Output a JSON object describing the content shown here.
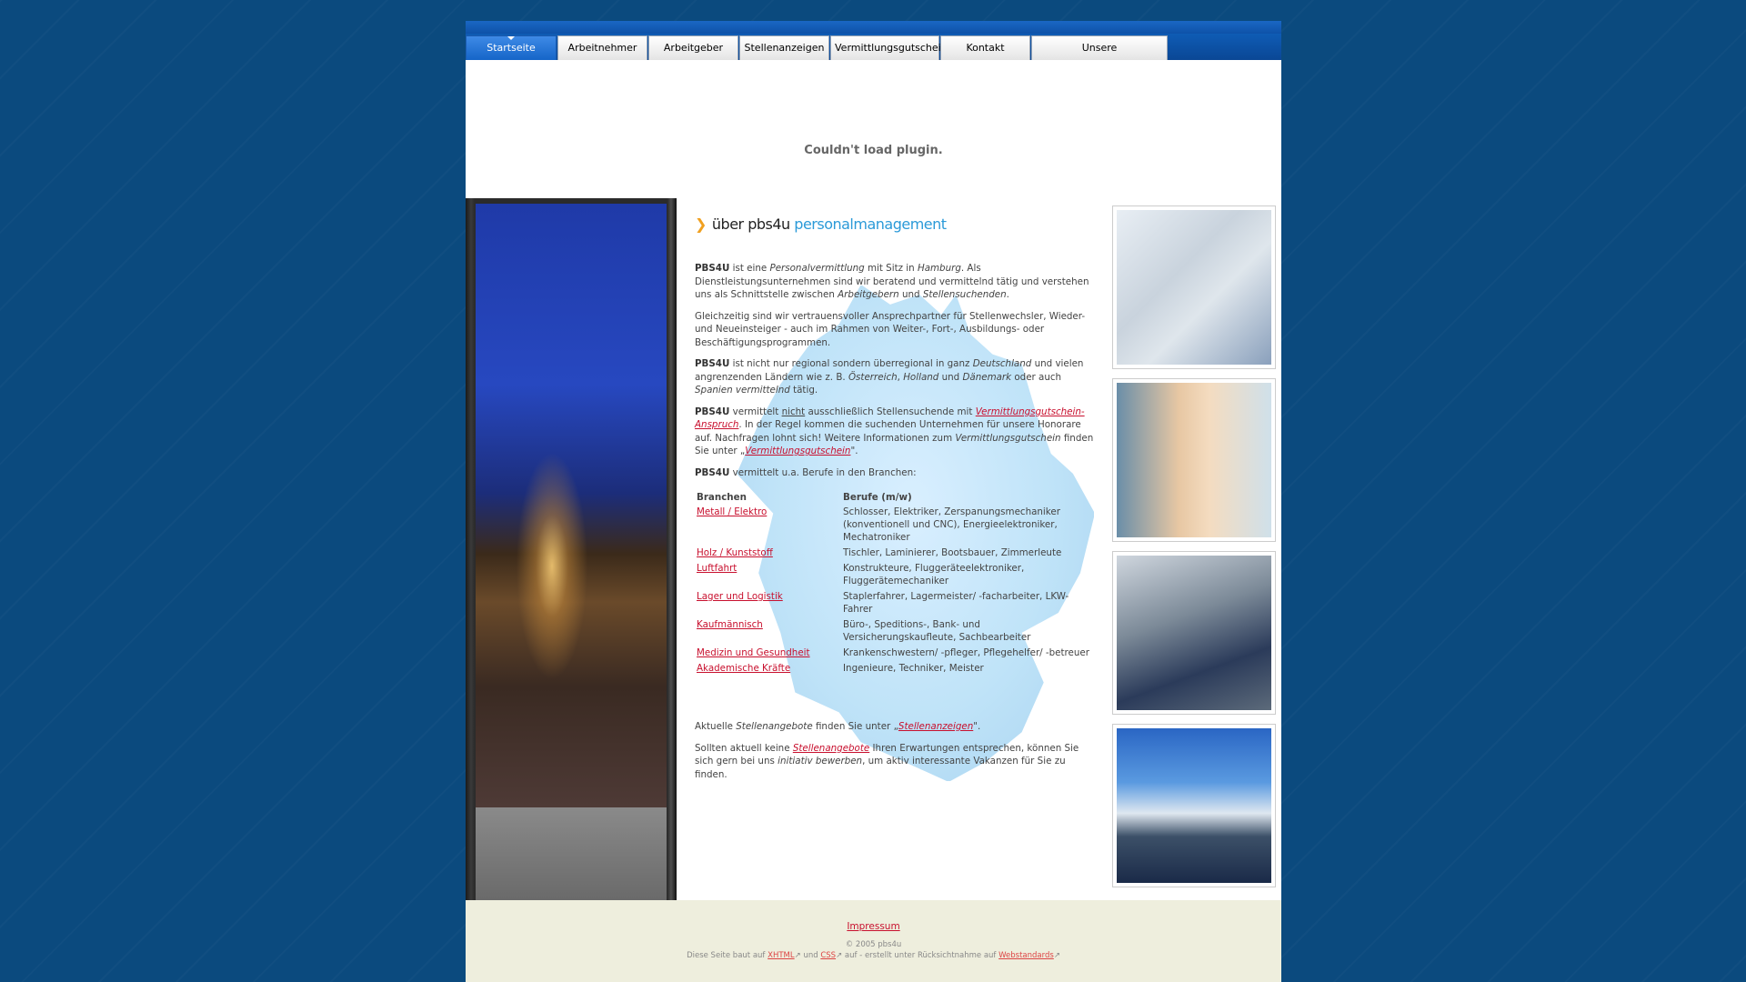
{
  "nav": [
    {
      "label": "Startseite",
      "active": true
    },
    {
      "label": "Arbeitnehmer"
    },
    {
      "label": "Arbeitgeber"
    },
    {
      "label": "Stellenanzeigen"
    },
    {
      "label": "Vermittlungsgutschein"
    },
    {
      "label": "Kontakt"
    },
    {
      "label": "Unsere Kooperationspartner"
    }
  ],
  "plugin_message": "Couldn't load plugin.",
  "heading": {
    "part1": "über pbs4u",
    "part2": "personalmanagement"
  },
  "body": {
    "p1": {
      "brand": "PBS4U",
      "t1": " ist eine ",
      "i1": "Personalvermittlung",
      "t2": " mit Sitz in ",
      "i2": "Hamburg",
      "t3": ". Als Dienstleistungsunternehmen sind wir beratend und vermittelnd tätig und verstehen uns als Schnittstelle zwischen ",
      "i3": "Arbeitgebern",
      "t4": " und ",
      "i4": "Stellensuchenden",
      "t5": "."
    },
    "p2": "Gleichzeitig sind wir vertrauensvoller Ansprechpartner für Stellenwechsler, Wieder- und Neueinsteiger - auch im Rahmen von Weiter-, Fort-, Ausbildungs- oder Beschäftigungsprogrammen.",
    "p3": {
      "brand": "PBS4U",
      "t1": " ist nicht nur regional sondern überregional in ganz ",
      "i1": "Deutschland",
      "t2": " und vielen angrenzenden Ländern wie z. B. ",
      "i2": "Österreich",
      "t3": ", ",
      "i3": "Holland",
      "t4": " und ",
      "i4": "Dänemark",
      "t5": " oder auch ",
      "i5": "Spanien vermittelnd",
      "t6": " tätig."
    },
    "p4": {
      "brand": "PBS4U",
      "t1": " vermittelt ",
      "u1": "nicht",
      "t2": " ausschließlich Stellensuchende mit ",
      "link1": "Vermittlungsgutschein-Anspruch",
      "t3": ". In der Regel kommen die suchenden Unternehmen für unsere Honorare auf. Nachfragen lohnt sich! Weitere Informationen zum ",
      "i1": "Vermittlungsgutschein",
      "t4": " finden Sie unter „",
      "link2": "Vermittlungsgutschein",
      "t5": "\"."
    },
    "p5": {
      "brand": "PBS4U",
      "t1": " vermittelt u.a. Berufe in den Branchen:"
    }
  },
  "table": {
    "headers": [
      "Branchen",
      "Berufe (m/w)"
    ],
    "rows": [
      {
        "branche": "Metall / Elektro",
        "berufe": "Schlosser, Elektriker, Zerspanungsmechaniker (konventionell und CNC), Energieelektroniker, Mechatroniker"
      },
      {
        "branche": "Holz / Kunststoff",
        "berufe": "Tischler, Laminierer, Bootsbauer, Zimmerleute"
      },
      {
        "branche": "Luftfahrt",
        "berufe": "Konstrukteure, Fluggeräteelektroniker, Fluggerätemechaniker"
      },
      {
        "branche": "Lager und Logistik",
        "berufe": "Staplerfahrer, Lagermeister/ -facharbeiter, LKW-Fahrer"
      },
      {
        "branche": "Kaufmännisch",
        "berufe": "Büro-, Speditions-, Bank- und Versicherungskaufleute, Sachbearbeiter"
      },
      {
        "branche": "Medizin und Gesundheit",
        "berufe": "Krankenschwestern/ -pfleger, Pflegehelfer/ -betreuer"
      },
      {
        "branche": "Akademische Kräfte",
        "berufe": "Ingenieure, Techniker, Meister"
      }
    ]
  },
  "after": {
    "p6": {
      "t1": "Aktuelle ",
      "i1": "Stellenangebote",
      "t2": " finden Sie unter „",
      "link1": "Stellenanzeigen",
      "t3": "\"."
    },
    "p7": {
      "t1": "Sollten aktuell keine ",
      "link1": "Stellenangebote",
      "t2": " Ihren Erwartungen entsprechen, können Sie sich gern bei uns ",
      "i1": "initiativ bewerben",
      "t3": ", um aktiv interessante Vakanzen für Sie zu finden."
    }
  },
  "footer": {
    "impressum": "Impressum",
    "copyright": "© 2005 pbs4u",
    "meta": {
      "t1": "Diese Seite baut auf ",
      "l1": "XHTML",
      "t2": " und ",
      "l2": "CSS",
      "t3": " auf - erstellt unter Rücksichtnahme auf ",
      "l3": "Webstandards"
    }
  },
  "colors": {
    "background": "#0b4a7e",
    "accent": "#2b9ad8",
    "link": "#c8102e",
    "nav_active": "#1565c8"
  }
}
